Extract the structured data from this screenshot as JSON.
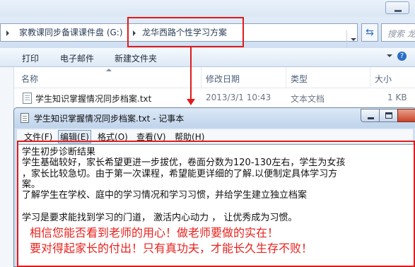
{
  "explorer": {
    "breadcrumb": [
      "家教课同步备课课件盘 (G:)",
      "龙华西路个性学习方案"
    ],
    "search_placeholder": "搜索 龙华",
    "toolbar": [
      "打印",
      "电子邮件",
      "新建文件夹"
    ],
    "columns": [
      "名称",
      "修改日期",
      "类型",
      "大小"
    ],
    "file": {
      "name": "学生知识掌握情况同步档案.txt",
      "modified": "2013/3/1 10:43",
      "type": "文本文档",
      "size": "1 KB"
    }
  },
  "notepad": {
    "title": "学生知识掌握情况同步档案.txt - 记事本",
    "menu": [
      {
        "label": "文件(",
        "key": "F",
        "tail": ")"
      },
      {
        "label": "编辑(",
        "key": "E",
        "tail": ")"
      },
      {
        "label": "格式(",
        "key": "O",
        "tail": ")"
      },
      {
        "label": "查看(",
        "key": "V",
        "tail": ")"
      },
      {
        "label": "帮助(",
        "key": "H",
        "tail": ")"
      }
    ],
    "lines": [
      "学生初步诊断结果",
      "学生基础较好，家长希望更进一步拔优，卷面分数为120-130左右，学生为女孩",
      "，家长比较急切。由于第一次课程，希望能更详细的了解.以便制定具体学习方",
      "案。",
      "了解学生在学校、庭中的学习情况和学习习惯，并给学生建立独立档案",
      "",
      "学习是要求能找到学习的门道，    激活内心动力   ，  让优秀成为习惯。"
    ],
    "annotation": [
      "相信您能否看到老师的用心！做老师要做的实在！",
      "要对得起家长的付出！只有真功夫，才能长久生存不败！"
    ]
  },
  "colors": {
    "highlight": "#e01b1b",
    "annotation_text": "#e8221e"
  }
}
